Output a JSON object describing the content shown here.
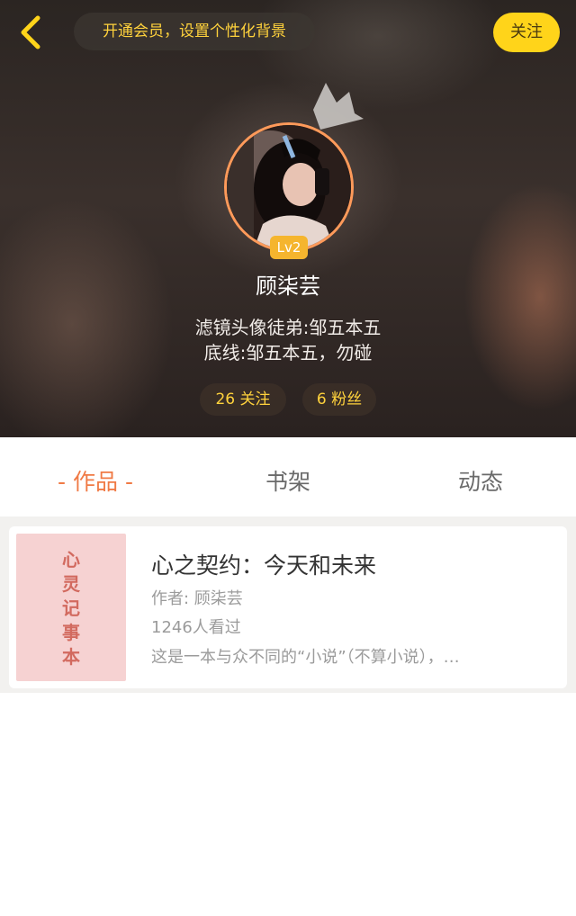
{
  "header": {
    "vip_banner": "开通会员，设置个性化背景",
    "follow_label": "关注",
    "level": "Lv2",
    "username": "顾柒芸",
    "bio_line1": "滤镜头像徒弟:邹五本五",
    "bio_line2": "底线:邹五本五，勿碰",
    "following": "26 关注",
    "fans": "6 粉丝"
  },
  "tabs": {
    "works": "- 作品 -",
    "bookshelf": "书架",
    "activity": "动态"
  },
  "book": {
    "cover_text": "心灵记事本",
    "title": "心之契约：今天和未来",
    "author": "作者: 顾柒芸",
    "views": "1246人看过",
    "description": "这是一本与众不同的“小说”（不算小说），…"
  },
  "colors": {
    "accent_yellow": "#ffd41a",
    "vip_text": "#ffd23c",
    "tab_active": "#f07a45",
    "avatar_ring": "#ff9a5a",
    "level_badge": "#f5b52e",
    "cover_bg": "#f6d2d2"
  },
  "icons": {
    "back": "chevron-left-icon",
    "crown": "crown-icon"
  }
}
